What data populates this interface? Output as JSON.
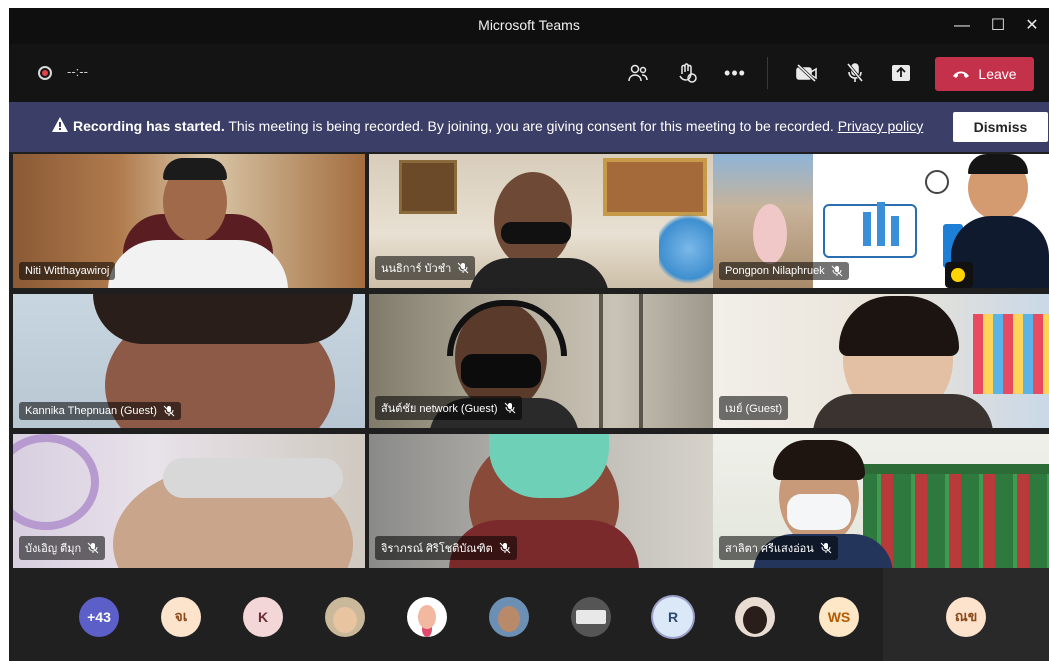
{
  "window": {
    "title": "Microsoft Teams",
    "controls": {
      "minimize": "—",
      "maximize": "☐",
      "close": "✕"
    }
  },
  "toolbar": {
    "timer": "--:--",
    "leave_label": "Leave",
    "icons": [
      "people-icon",
      "reactions-icon",
      "more-icon",
      "camera-off-icon",
      "mic-off-icon",
      "share-icon"
    ]
  },
  "banner": {
    "title": "Recording has started.",
    "message": "This meeting is being recorded. By joining, you are giving consent for this meeting to be recorded.",
    "link": "Privacy policy",
    "dismiss_label": "Dismiss"
  },
  "participants": [
    {
      "name": "Niti Witthayawiroj",
      "muted": false
    },
    {
      "name": "นนธิการ์ บัวชำ",
      "muted": true
    },
    {
      "name": "Pongpon Nilaphruek",
      "muted": true
    },
    {
      "name": "Kannika Thepnuan (Guest)",
      "muted": true
    },
    {
      "name": "สันต์ชัย network (Guest)",
      "muted": true
    },
    {
      "name": "เมย์ (Guest)",
      "muted": false
    },
    {
      "name": "บังเอิญ ตีมุก",
      "muted": true
    },
    {
      "name": "จิราภรณ์ ศิริโชติบัณฑิต",
      "muted": true
    },
    {
      "name": "สาลิตา ศรีแสงอ่อน",
      "muted": true
    }
  ],
  "roster": [
    {
      "label": "+43",
      "bg": "#5b5fc7",
      "fg": "#ffffff"
    },
    {
      "label": "จเ",
      "bg": "#fbe3cc",
      "fg": "#8a4b1d"
    },
    {
      "label": "K",
      "bg": "#f3d6d8",
      "fg": "#6b2c32"
    },
    {
      "label": "",
      "bg": "#c9b89a",
      "fg": "#ffffff",
      "photo": "child"
    },
    {
      "label": "",
      "bg": "#ffffff",
      "fg": "#ffffff",
      "photo": "cartoon"
    },
    {
      "label": "",
      "bg": "#6c8fb4",
      "fg": "#ffffff",
      "photo": "man"
    },
    {
      "label": "",
      "bg": "#555555",
      "fg": "#ffffff",
      "photo": "sign"
    },
    {
      "label": "R",
      "bg": "#dbe8f7",
      "fg": "#2e4a72",
      "ring": true
    },
    {
      "label": "",
      "bg": "#e8dcd3",
      "fg": "#ffffff",
      "photo": "woman"
    },
    {
      "label": "WS",
      "bg": "#fde7c6",
      "fg": "#b25a00"
    },
    {
      "label": "ณข",
      "bg": "#fde2cc",
      "fg": "#8a4b1d"
    }
  ]
}
